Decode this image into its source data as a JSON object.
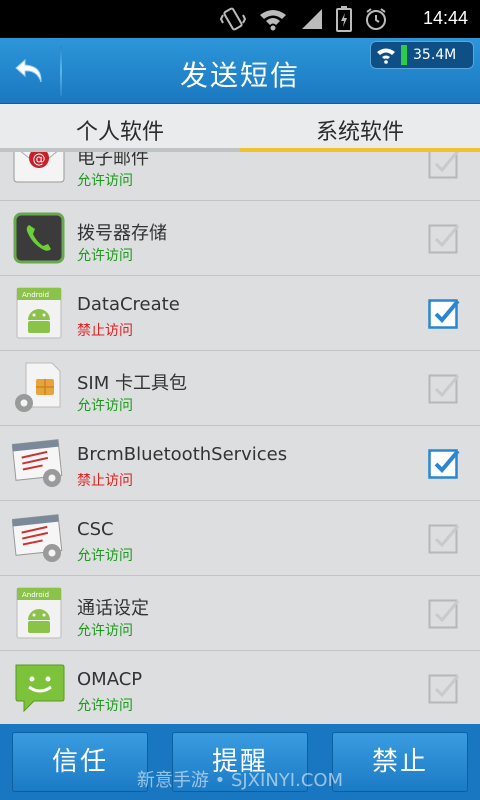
{
  "status": {
    "time": "14:44"
  },
  "header": {
    "title": "发送短信",
    "net_speed": "35.4M"
  },
  "tabs": [
    {
      "label": "个人软件",
      "active": false
    },
    {
      "label": "系统软件",
      "active": true
    }
  ],
  "apps": [
    {
      "name": "电子邮件",
      "status": "允许访问",
      "allowed": true,
      "checked": false,
      "icon": "email-icon"
    },
    {
      "name": "拨号器存储",
      "status": "允许访问",
      "allowed": true,
      "checked": false,
      "icon": "phone-icon"
    },
    {
      "name": "DataCreate",
      "status": "禁止访问",
      "allowed": false,
      "checked": true,
      "icon": "android-icon"
    },
    {
      "name": "SIM 卡工具包",
      "status": "允许访问",
      "allowed": true,
      "checked": false,
      "icon": "sim-icon"
    },
    {
      "name": "BrcmBluetoothServices",
      "status": "禁止访问",
      "allowed": false,
      "checked": true,
      "icon": "system-window-icon"
    },
    {
      "name": "CSC",
      "status": "允许访问",
      "allowed": true,
      "checked": false,
      "icon": "system-window-icon"
    },
    {
      "name": "通话设定",
      "status": "允许访问",
      "allowed": true,
      "checked": false,
      "icon": "android-icon"
    },
    {
      "name": "OMACP",
      "status": "允许访问",
      "allowed": true,
      "checked": false,
      "icon": "message-icon"
    }
  ],
  "actions": {
    "trust": "信任",
    "remind": "提醒",
    "forbid": "禁止"
  },
  "watermark": "新意手游 • SJXINYI.COM",
  "colors": {
    "allow": "#1a9a1a",
    "deny": "#e02020",
    "accent": "#1a78c0",
    "tab_indicator": "#f2c12e"
  }
}
